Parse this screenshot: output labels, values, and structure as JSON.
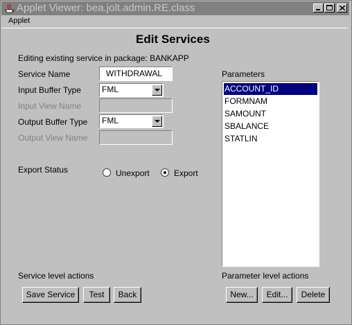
{
  "window": {
    "title": "Applet Viewer: bea.jolt.admin.RE.class",
    "controls": [
      "minimize",
      "maximize",
      "close"
    ]
  },
  "menubar": {
    "items": [
      "Applet"
    ]
  },
  "page": {
    "heading": "Edit Services",
    "context": "Editing existing service in package: BANKAPP"
  },
  "form": {
    "service_name_label": "Service Name",
    "service_name_value": "WITHDRAWAL",
    "input_buffer_type_label": "Input Buffer Type",
    "input_buffer_type_value": "FML",
    "input_view_name_label": "Input View Name",
    "input_view_name_value": "",
    "output_buffer_type_label": "Output Buffer Type",
    "output_buffer_type_value": "FML",
    "output_view_name_label": "Output View Name",
    "output_view_name_value": "",
    "export_status_label": "Export Status",
    "export_options": [
      {
        "label": "Unexport",
        "checked": false
      },
      {
        "label": "Export",
        "checked": true
      }
    ]
  },
  "parameters": {
    "label": "Parameters",
    "items": [
      "ACCOUNT_ID",
      "FORMNAM",
      "SAMOUNT",
      "SBALANCE",
      "STATLIN"
    ],
    "selected": "ACCOUNT_ID"
  },
  "service_actions": {
    "label": "Service level actions",
    "buttons": [
      "Save Service",
      "Test",
      "Back"
    ]
  },
  "parameter_actions": {
    "label": "Parameter level actions",
    "buttons": [
      "New...",
      "Edit...",
      "Delete"
    ]
  },
  "colors": {
    "window_bg": "#c0c0c0",
    "titlebar_inactive": "#808080",
    "selection": "#000080"
  }
}
